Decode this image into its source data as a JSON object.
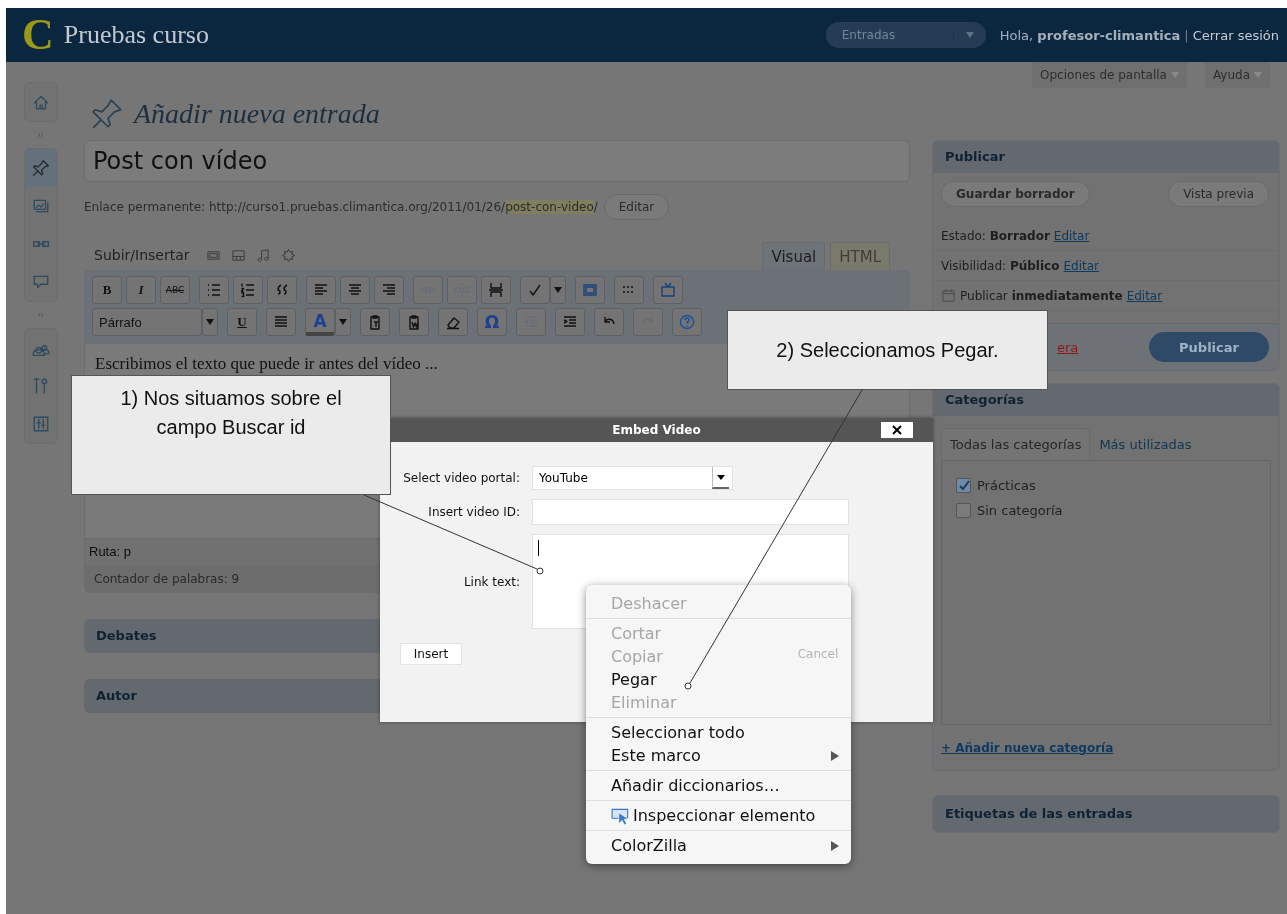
{
  "header": {
    "logo_letter": "C",
    "site_title": "Pruebas curso",
    "menu": "Entradas",
    "greeting": "Hola, **profesor-climantica**",
    "separator": "|",
    "logout": "Cerrar sesión"
  },
  "screen_tabs": [
    {
      "label": "Opciones de pantalla"
    },
    {
      "label": "Ayuda"
    }
  ],
  "sidebar": {
    "groups": [
      {
        "items": [
          {
            "kind": "home",
            "selected": false
          }
        ]
      },
      {
        "items": [
          {
            "kind": "pin",
            "selected": true
          },
          {
            "kind": "media",
            "selected": false
          },
          {
            "kind": "link",
            "selected": false
          },
          {
            "kind": "comment",
            "selected": false
          }
        ]
      },
      {
        "items": [
          {
            "kind": "users",
            "selected": false
          },
          {
            "kind": "tools",
            "selected": false
          },
          {
            "kind": "settings",
            "selected": false
          }
        ]
      }
    ]
  },
  "page_title": "Añadir nueva entrada",
  "post_title": "Post con vídeo",
  "permalink": {
    "label": "Enlace permanente: http://curso1.pruebas.climantica.org/2011/01/26/",
    "slug": "post-con-video",
    "end": "/",
    "button": "Editar"
  },
  "editor": {
    "upload_label": "Subir/Insertar",
    "tabs": [
      {
        "label": "Visual",
        "selected": true
      },
      {
        "label": "HTML",
        "selected": false
      }
    ],
    "toolbar": [
      {
        "groups": [
          {
            "items": [
              {
                "kind": "bold",
                "label": "B",
                "disabled": false
              },
              {
                "kind": "italic",
                "label": "I",
                "disabled": false
              },
              {
                "kind": "strike",
                "label": "ABC",
                "disabled": false
              }
            ]
          },
          {
            "items": [
              {
                "kind": "bullets",
                "disabled": false
              },
              {
                "kind": "numbers",
                "disabled": false
              },
              {
                "kind": "quote",
                "disabled": false
              }
            ]
          },
          {
            "items": [
              {
                "kind": "align_left",
                "disabled": false
              },
              {
                "kind": "align_center",
                "disabled": false
              },
              {
                "kind": "align_right",
                "disabled": false
              }
            ]
          },
          {
            "items": [
              {
                "kind": "link",
                "disabled": true
              },
              {
                "kind": "unlink",
                "disabled": true
              },
              {
                "kind": "pagebreak",
                "disabled": false
              }
            ]
          },
          {
            "items": [
              {
                "kind": "spell",
                "disabled": false
              },
              {
                "kind": "dropdown",
                "disabled": false
              }
            ]
          },
          {
            "items": [
              {
                "kind": "fullscreen",
                "disabled": false
              }
            ]
          },
          {
            "items": [
              {
                "kind": "kitchen",
                "disabled": false
              }
            ]
          },
          {
            "items": [
              {
                "kind": "video",
                "disabled": false
              }
            ]
          }
        ]
      },
      {
        "groups": [
          {
            "items": [
              {
                "kind": "select",
                "label": "Párrafo",
                "disabled": false
              },
              {
                "kind": "dropdown",
                "disabled": false
              }
            ]
          },
          {
            "items": [
              {
                "kind": "underline",
                "label": "U",
                "disabled": false
              }
            ]
          },
          {
            "items": [
              {
                "kind": "justify",
                "disabled": false
              }
            ]
          },
          {
            "items": [
              {
                "kind": "color",
                "label": "A",
                "disabled": false
              },
              {
                "kind": "dropdown",
                "disabled": false
              }
            ]
          },
          {
            "items": [
              {
                "kind": "paste_text",
                "disabled": false
              }
            ]
          },
          {
            "items": [
              {
                "kind": "paste_word",
                "disabled": false
              }
            ]
          },
          {
            "items": [
              {
                "kind": "eraser",
                "disabled": false
              }
            ]
          },
          {
            "items": [
              {
                "kind": "symbol",
                "label": "Ω",
                "disabled": false
              }
            ]
          },
          {
            "items": [
              {
                "kind": "outdent",
                "disabled": true
              }
            ]
          },
          {
            "items": [
              {
                "kind": "indent",
                "disabled": false
              }
            ]
          },
          {
            "items": [
              {
                "kind": "undo",
                "disabled": false
              }
            ]
          },
          {
            "items": [
              {
                "kind": "redo",
                "disabled": true
              }
            ]
          },
          {
            "items": [
              {
                "kind": "help",
                "disabled": false
              }
            ]
          }
        ]
      }
    ],
    "content": "Escribimos el texto que puede ir antes del vídeo ...",
    "path": "Ruta: p",
    "word_count": "Contador de palabras: 9"
  },
  "boxes": [
    {
      "title": "Debates"
    },
    {
      "title": "Autor"
    }
  ],
  "publish": {
    "title": "Publicar",
    "save": "Guardar borrador",
    "preview": "Vista previa",
    "rows": [
      {
        "kind": "text",
        "text": "Estado: **Borrador**",
        "link": "Editar"
      },
      {
        "kind": "text",
        "text": "Visibilidad: **Público**",
        "link": "Editar"
      },
      {
        "kind": "date",
        "text": "Publicar **inmediatamente**",
        "link": "Editar"
      }
    ],
    "trash": "era",
    "button": "Publicar"
  },
  "categories": {
    "title": "Categorías",
    "tabs": [
      {
        "label": "Todas las categorías",
        "selected": true
      },
      {
        "label": "Más utilizadas",
        "selected": false
      }
    ],
    "items": [
      {
        "label": "Prácticas",
        "checked": true
      },
      {
        "label": "Sin categoría",
        "checked": false
      }
    ],
    "add_link": "+ Añadir nueva categoría"
  },
  "tags_box": {
    "title": "Etiquetas de las entradas"
  },
  "dialog": {
    "title": "Embed Video",
    "portal_label": "Select video portal:",
    "portal_value": "YouTube",
    "id_label": "Insert video ID:",
    "link_label": "Link text:",
    "insert": "Insert",
    "cancel": "Cancel"
  },
  "context_menu": {
    "groups": [
      {
        "items": [
          {
            "kind": "plain",
            "label": "Deshacer",
            "disabled": true,
            "submenu": false
          }
        ]
      },
      {
        "items": [
          {
            "kind": "plain",
            "label": "Cortar",
            "disabled": true,
            "submenu": false
          },
          {
            "kind": "plain",
            "label": "Copiar",
            "disabled": true,
            "submenu": false
          },
          {
            "kind": "plain",
            "label": "Pegar",
            "disabled": false,
            "submenu": false
          },
          {
            "kind": "plain",
            "label": "Eliminar",
            "disabled": true,
            "submenu": false
          }
        ]
      },
      {
        "items": [
          {
            "kind": "plain",
            "label": "Seleccionar todo",
            "disabled": false,
            "submenu": false
          },
          {
            "kind": "plain",
            "label": "Este marco",
            "disabled": false,
            "submenu": true
          }
        ]
      },
      {
        "items": [
          {
            "kind": "plain",
            "label": "Añadir diccionarios…",
            "disabled": false,
            "submenu": false
          }
        ]
      },
      {
        "items": [
          {
            "kind": "inspect",
            "label": "Inspeccionar elemento",
            "disabled": false,
            "submenu": false
          }
        ]
      },
      {
        "items": [
          {
            "kind": "plain",
            "label": "ColorZilla",
            "disabled": false,
            "submenu": true
          }
        ]
      }
    ]
  },
  "callouts": [
    {
      "text": "1) Nos situamos sobre el campo Buscar id"
    },
    {
      "text": "2) Seleccionamos Pegar."
    }
  ]
}
